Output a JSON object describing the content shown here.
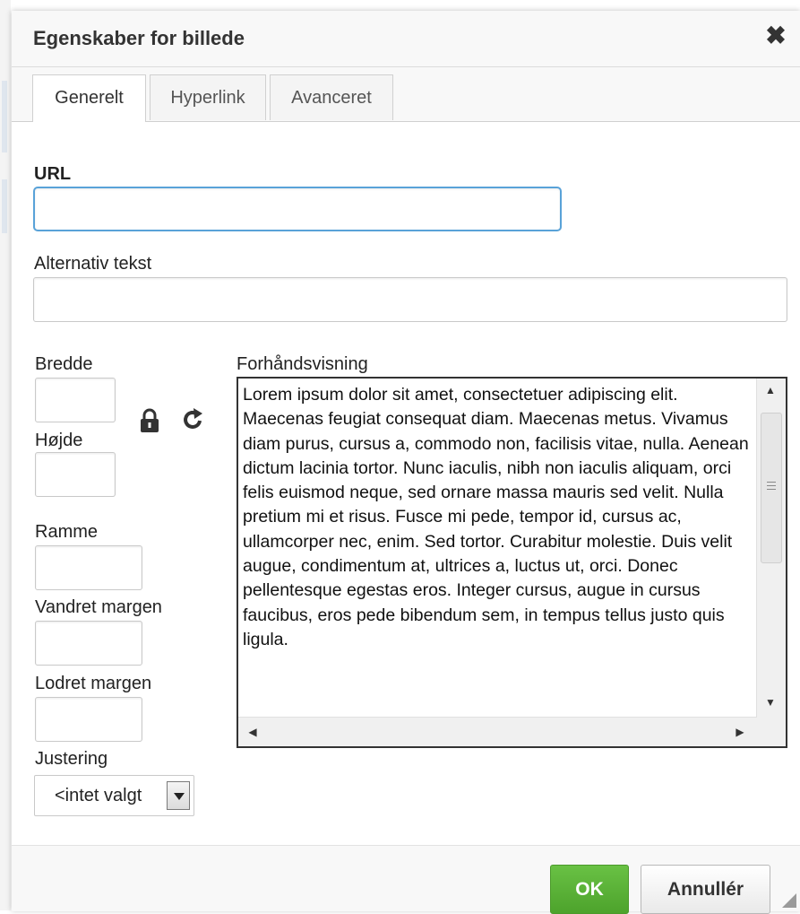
{
  "dialog": {
    "title": "Egenskaber for billede",
    "close_icon": "close-icon"
  },
  "tabs": [
    {
      "label": "Generelt",
      "active": true
    },
    {
      "label": "Hyperlink",
      "active": false
    },
    {
      "label": "Avanceret",
      "active": false
    }
  ],
  "form": {
    "url_label": "URL",
    "url_value": "",
    "alt_label": "Alternativ tekst",
    "alt_value": "",
    "width_label": "Bredde",
    "width_value": "",
    "height_label": "Højde",
    "height_value": "",
    "lock_icon": "lock-icon",
    "reset_icon": "reset-size-icon",
    "border_label": "Ramme",
    "border_value": "",
    "hspace_label": "Vandret margen",
    "hspace_value": "",
    "vspace_label": "Lodret margen",
    "vspace_value": "",
    "align_label": "Justering",
    "align_value": "<intet valgt"
  },
  "preview": {
    "label": "Forhåndsvisning",
    "text": "Lorem ipsum dolor sit amet, consectetuer adipiscing elit. Maecenas feugiat consequat diam. Maecenas metus. Vivamus diam purus, cursus a, commodo non, facilisis vitae, nulla. Aenean dictum lacinia tortor. Nunc iaculis, nibh non iaculis aliquam, orci felis euismod neque, sed ornare massa mauris sed velit. Nulla pretium mi et risus. Fusce mi pede, tempor id, cursus ac, ullamcorper nec, enim. Sed tortor. Curabitur molestie. Duis velit augue, condimentum at, ultrices a, luctus ut, orci. Donec pellentesque egestas eros. Integer cursus, augue in cursus faucibus, eros pede bibendum sem, in tempus tellus justo quis ligula."
  },
  "footer": {
    "ok_label": "OK",
    "cancel_label": "Annullér"
  },
  "colors": {
    "accent_focus": "#59a2d8",
    "ok_green": "#56ad33",
    "title_bg": "#f8f8f8"
  }
}
